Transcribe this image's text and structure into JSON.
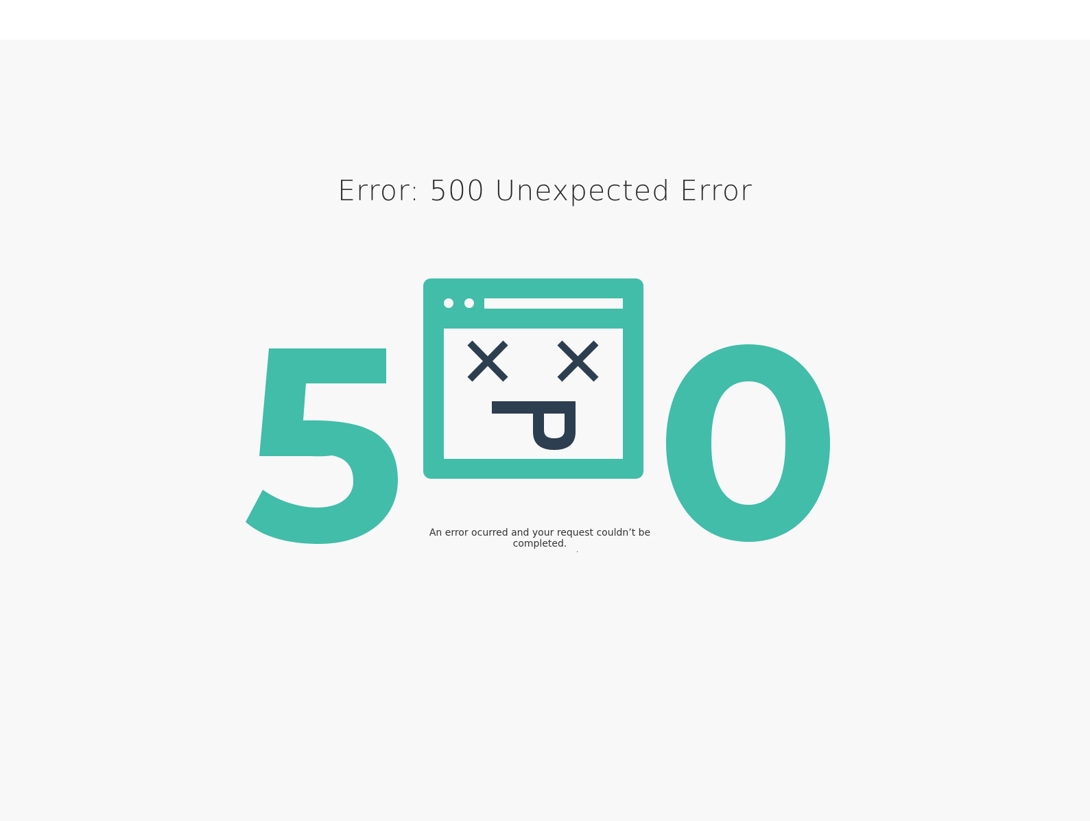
{
  "page": {
    "title": "Error: 500 Unexpected Error",
    "message": "An error ocurred and your request couldn’t be completed.",
    "trailing_mark": "."
  },
  "graphic": {
    "digit_left": "5",
    "digit_right": "0",
    "icon": "dead-browser-window-icon",
    "accent_color": "#41bda9",
    "face_color": "#2c3e50",
    "background_color": "#f8f8f8"
  }
}
